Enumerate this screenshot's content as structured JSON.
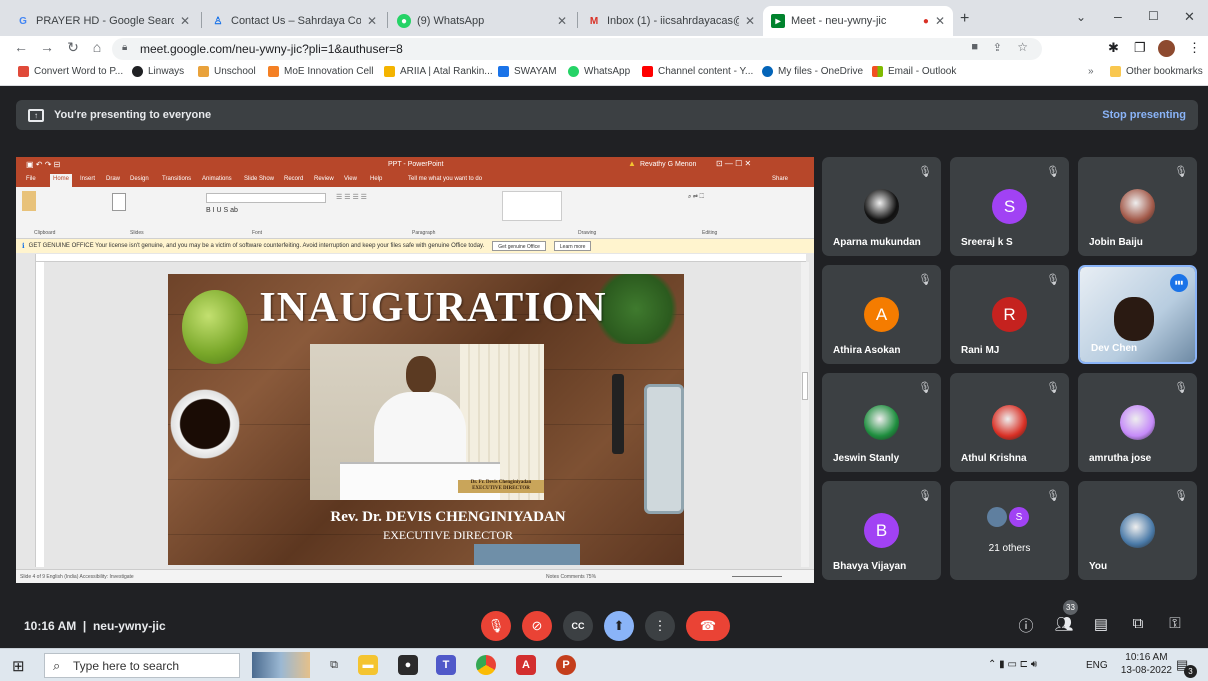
{
  "tabs": [
    {
      "label": "PRAYER HD - Google Search",
      "icon": "google-icon"
    },
    {
      "label": "Contact Us – Sahrdaya College o",
      "icon": "college-icon"
    },
    {
      "label": "(9) WhatsApp",
      "icon": "whatsapp-icon"
    },
    {
      "label": "Inbox (1) - iicsahrdayacas@gmai",
      "icon": "gmail-icon"
    },
    {
      "label": "Meet - neu-ywny-jic",
      "icon": "meet-icon"
    }
  ],
  "url": "meet.google.com/neu-ywny-jic?pli=1&authuser=8",
  "bookmarks": [
    "Convert Word to P...",
    "Linways",
    "Unschool",
    "MoE Innovation Cell",
    "ARIIA | Atal Rankin...",
    "SWAYAM",
    "WhatsApp",
    "Channel content - Y...",
    "My files - OneDrive",
    "Email - Outlook",
    "Other bookmarks"
  ],
  "presenting": {
    "text": "You're presenting to everyone",
    "stop": "Stop presenting"
  },
  "ppt": {
    "window_title": "PPT - PowerPoint",
    "user": "Revathy G Menon",
    "ribbon_tabs": [
      "File",
      "Home",
      "Insert",
      "Draw",
      "Design",
      "Transitions",
      "Animations",
      "Slide Show",
      "Record",
      "Review",
      "View",
      "Help",
      "Tell me what you want to do"
    ],
    "share": "Share",
    "groups": [
      "Clipboard",
      "Slides",
      "Font",
      "Paragraph",
      "Drawing",
      "Editing"
    ],
    "genuine_text": "GET GENUINE OFFICE  Your license isn't genuine, and you may be a victim of software counterfeiting. Avoid interruption and keep your files safe with genuine Office today.",
    "genuine_btn": "Get genuine Office",
    "learn_btn": "Learn more",
    "status_left": "Slide 4 of 9    English (India)    Accessibility: Investigate",
    "status_right": "Notes   Comments       75%",
    "slide": {
      "title": "INAUGURATION",
      "name": "Rev. Dr. DEVIS CHENGINIYADAN",
      "designation": "EXECUTIVE DIRECTOR",
      "plate_name": "Dr. Fr. Devis Chenginiyadan",
      "plate_title": "EXECUTIVE DIRECTOR"
    }
  },
  "participants": [
    {
      "name": "Aparna mukundan",
      "avatar": "",
      "color": "#111111",
      "type": "image"
    },
    {
      "name": "Sreeraj k S",
      "avatar": "S",
      "color": "#a142f4"
    },
    {
      "name": "Jobin Baiju",
      "avatar": "",
      "color": "#a35a4a",
      "type": "image"
    },
    {
      "name": "Athira Asokan",
      "avatar": "A",
      "color": "#f57c00"
    },
    {
      "name": "Rani MJ",
      "avatar": "R",
      "color": "#c5221f"
    },
    {
      "name": "Dev Chen",
      "avatar": "",
      "color": "#b8cde0",
      "type": "video"
    },
    {
      "name": "Jeswin Stanly",
      "avatar": "",
      "color": "#1e8e3e",
      "type": "image"
    },
    {
      "name": "Athul Krishna",
      "avatar": "",
      "color": "#d93025",
      "type": "image"
    },
    {
      "name": "amrutha jose",
      "avatar": "",
      "color": "#c58af9",
      "type": "image"
    },
    {
      "name": "Bhavya Vijayan",
      "avatar": "B",
      "color": "#a142f4"
    },
    {
      "name": "21 others",
      "avatar": "S",
      "color": "#a142f4",
      "type": "others"
    },
    {
      "name": "You",
      "avatar": "",
      "color": "#4a7aa8",
      "type": "image"
    }
  ],
  "meeting": {
    "time": "10:16 AM",
    "code": "neu-ywny-jic",
    "participant_count": "33"
  },
  "taskbar": {
    "search_placeholder": "Type here to search",
    "time": "10:16 AM",
    "date": "13-08-2022",
    "lang": "ENG",
    "notif": "3"
  }
}
